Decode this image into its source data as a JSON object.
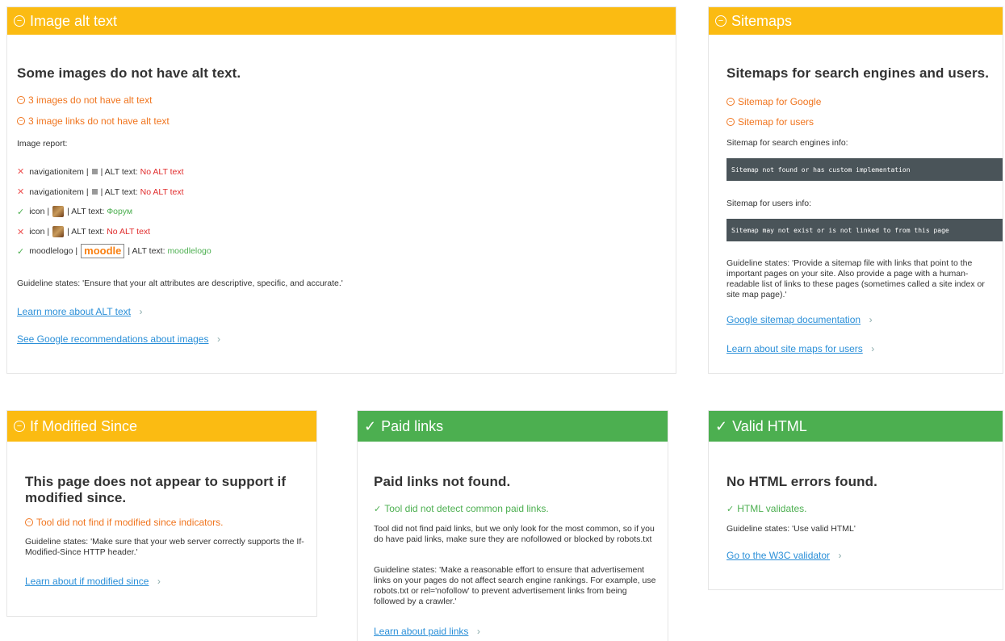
{
  "cards": {
    "image_alt": {
      "title": "Image alt text",
      "heading": "Some images do not have alt text.",
      "warn1": "3 images do not have alt text",
      "warn2": "3 image links do not have alt text",
      "report_label": "Image report:",
      "rows": [
        {
          "status": "fail",
          "name": "navigationitem |",
          "alt_label": "| ALT text:",
          "alt_value": "No ALT text",
          "thumb": "gray"
        },
        {
          "status": "fail",
          "name": "navigationitem |",
          "alt_label": "| ALT text:",
          "alt_value": "No ALT text",
          "thumb": "gray"
        },
        {
          "status": "pass",
          "name": "icon |",
          "alt_label": "| ALT text:",
          "alt_value": "Форум",
          "thumb": "image"
        },
        {
          "status": "fail",
          "name": "icon |",
          "alt_label": "| ALT text:",
          "alt_value": "No ALT text",
          "thumb": "image"
        },
        {
          "status": "pass",
          "name": "moodlelogo |",
          "alt_label": "| ALT text:",
          "alt_value": "moodlelogo",
          "thumb": "logo"
        }
      ],
      "logo_text_a": "moodle",
      "guideline": "Guideline states: 'Ensure that your alt attributes are descriptive, specific, and accurate.'",
      "link1": "Learn more about ALT text",
      "link2": "See Google recommendations about images"
    },
    "sitemaps": {
      "title": "Sitemaps",
      "heading": "Sitemaps for search engines and users.",
      "warn1": "Sitemap for Google",
      "warn2": "Sitemap for users",
      "info1_label": "Sitemap for search engines info:",
      "info1_code": "Sitemap not found or has custom implementation",
      "info2_label": "Sitemap for users info:",
      "info2_code": "Sitemap may not exist or is not linked to from this page",
      "guideline": "Guideline states: 'Provide a sitemap file with links that point to the important pages on your site. Also provide a page with a human-readable list of links to these pages (sometimes called a site index or site map page).'",
      "link1": "Google sitemap documentation",
      "link2": "Learn about site maps for users"
    },
    "modified": {
      "title": "If Modified Since",
      "heading": "This page does not appear to support if modified since.",
      "warn1": "Tool did not find if modified since indicators.",
      "guideline": "Guideline states: 'Make sure that your web server correctly supports the If-Modified-Since HTTP header.'",
      "link1": "Learn about if modified since"
    },
    "paid": {
      "title": "Paid links",
      "heading": "Paid links not found.",
      "ok1": "Tool did not detect common paid links.",
      "para1": "Tool did not find paid links, but we only look for the most common, so if you do have paid links, make sure they are nofollowed or blocked by robots.txt",
      "guideline": "Guideline states: 'Make a reasonable effort to ensure that advertisement links on your pages do not affect search engine rankings. For example, use robots.txt or rel='nofollow' to prevent advertisement links from being followed by a crawler.'",
      "link1": "Learn about paid links"
    },
    "html": {
      "title": "Valid HTML",
      "heading": "No HTML errors found.",
      "ok1": "HTML validates.",
      "guideline": "Guideline states: 'Use valid HTML'",
      "link1": "Go to the W3C validator"
    }
  },
  "colors": {
    "warning": "#fbbb12",
    "success": "#4caf50",
    "link": "#2a8fd8",
    "warn_text": "#f0751f"
  },
  "icons": {
    "warning_header": "minus-circle-icon",
    "success_header": "check-icon",
    "row_fail": "x-icon",
    "row_pass": "check-icon"
  }
}
